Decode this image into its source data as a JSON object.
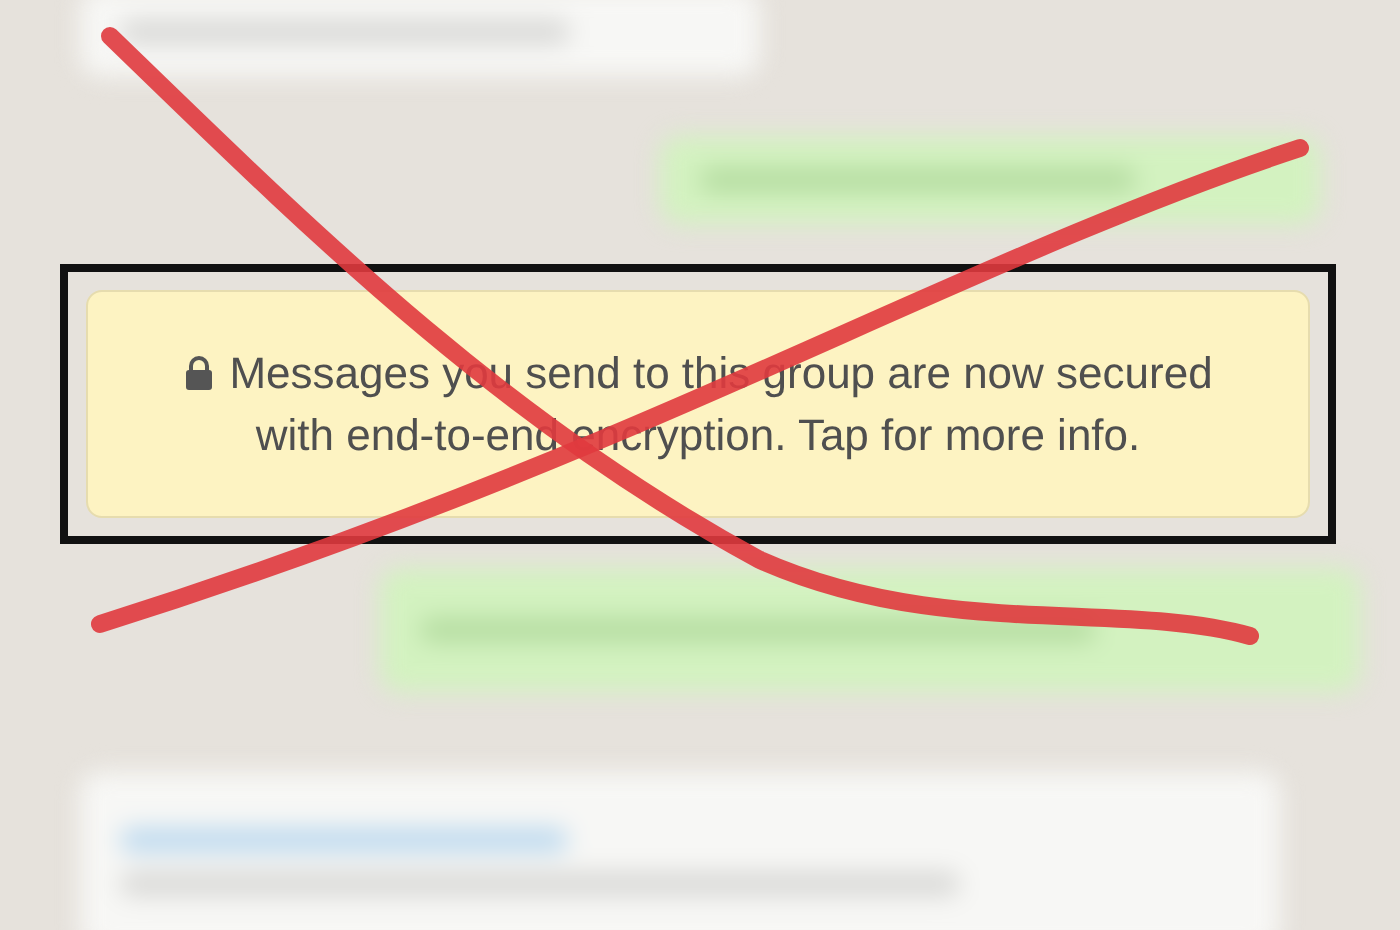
{
  "bubbles_above": [
    {
      "kind": "incoming"
    },
    {
      "kind": "outgoing"
    }
  ],
  "notice": {
    "text": "Messages you send to this group are now secured with end-to-end encryption. Tap for more info.",
    "framed": true,
    "crossed_out": true
  },
  "bubbles_below": [
    {
      "kind": "outgoing"
    },
    {
      "kind": "incoming"
    }
  ]
}
